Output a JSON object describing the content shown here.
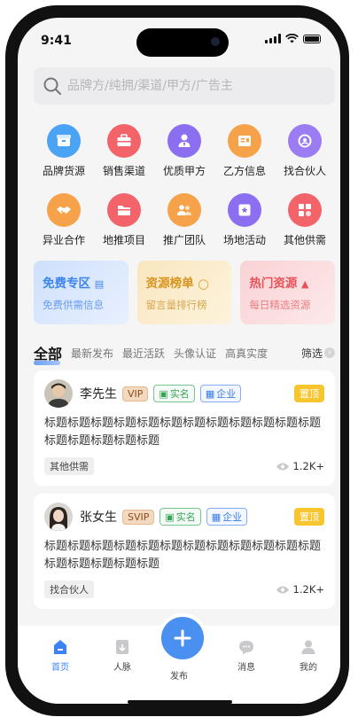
{
  "status": {
    "time": "9:41"
  },
  "search": {
    "placeholder": "品牌方/纯拥/渠道/甲方/广告主"
  },
  "categories": [
    {
      "label": "品牌货源",
      "icon": "box-icon",
      "color": "#4aa3f5"
    },
    {
      "label": "销售渠道",
      "icon": "briefcase-icon",
      "color": "#f2636a"
    },
    {
      "label": "优质甲方",
      "icon": "person-tie-icon",
      "color": "#8c6ef0"
    },
    {
      "label": "乙方信息",
      "icon": "id-card-icon",
      "color": "#f5a24a"
    },
    {
      "label": "找合伙人",
      "icon": "search-person-icon",
      "color": "#9b7cf2"
    },
    {
      "label": "异业合作",
      "icon": "handshake-icon",
      "color": "#f5a24a"
    },
    {
      "label": "地推项目",
      "icon": "folder-icon",
      "color": "#f2636a"
    },
    {
      "label": "推广团队",
      "icon": "team-icon",
      "color": "#f5a24a"
    },
    {
      "label": "场地活动",
      "icon": "star-badge-icon",
      "color": "#8c6ef0"
    },
    {
      "label": "其他供需",
      "icon": "apps-icon",
      "color": "#f2636a"
    }
  ],
  "promo": [
    {
      "title": "免费专区",
      "sub": "免费供需信息",
      "icon": "book-icon",
      "title_color": "#3c84ef",
      "sub_color": "#6a9df0",
      "bg": "#dbe8fd"
    },
    {
      "title": "资源榜单",
      "sub": "留言量排行榜",
      "icon": "medal-icon",
      "title_color": "#d9941e",
      "sub_color": "#d6a650",
      "bg": "#fbefd3"
    },
    {
      "title": "热门资源",
      "sub": "每日精选资源",
      "icon": "fire-icon",
      "title_color": "#e8525a",
      "sub_color": "#ec7c80",
      "bg": "#fbdedf"
    }
  ],
  "filters": {
    "tabs": [
      "全部",
      "最新发布",
      "最近活跃",
      "头像认证",
      "高真实度"
    ],
    "screen_label": "筛选"
  },
  "posts": [
    {
      "name": "李先生",
      "level": "VIP",
      "real": "实名",
      "ent": "企业",
      "top": "置顶",
      "text": "标题标题标题标题标题标题标题标题标题标题标题标题标题标题标题标题标题",
      "tag": "其他供需",
      "views": "1.2K+"
    },
    {
      "name": "张女生",
      "level": "SVIP",
      "real": "实名",
      "ent": "企业",
      "top": "置顶",
      "text": "标题标题标题标题标题标题标题标题标题标题标题标题标题标题标题标题标题",
      "tag": "找合伙人",
      "views": "1.2K+"
    }
  ],
  "tabbar": {
    "home": "首页",
    "network": "人脉",
    "publish": "发布",
    "messages": "消息",
    "mine": "我的",
    "accent": "#3b82f6"
  }
}
